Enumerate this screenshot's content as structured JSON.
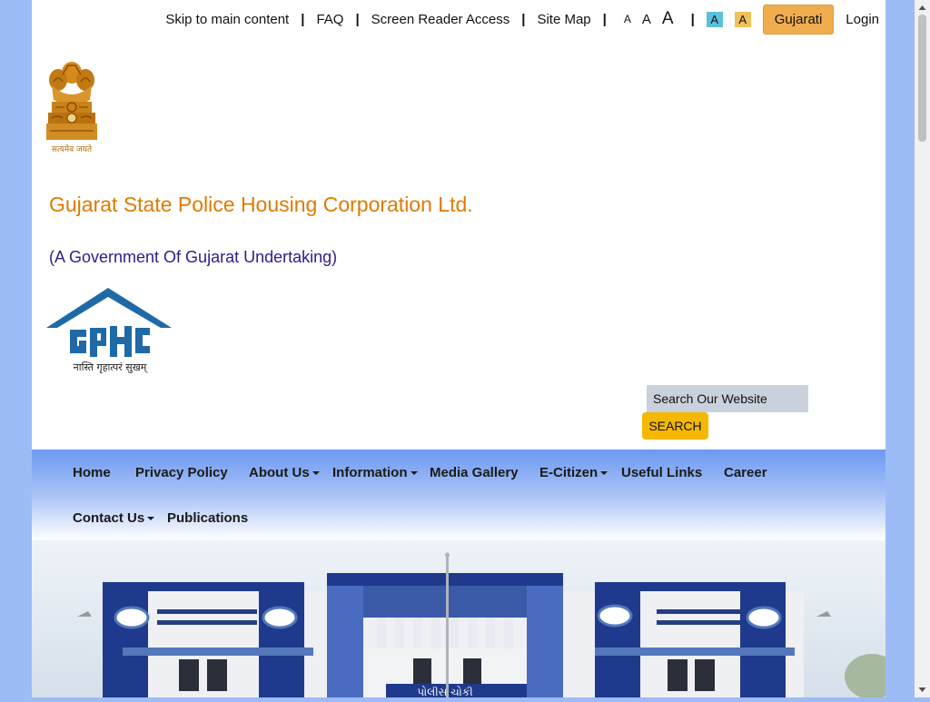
{
  "topbar": {
    "skip": "Skip to main content",
    "faq": "FAQ",
    "screen_reader": "Screen Reader Access",
    "site_map": "Site Map",
    "sep": "|",
    "font_small": "A",
    "font_normal": "A",
    "font_large": "A",
    "contrast_blue": "A",
    "contrast_yellow": "A",
    "language": "Gujarati",
    "login": "Login"
  },
  "header": {
    "emblem_motto": "सत्यमेव जयते",
    "org_name": "Gujarat State Police Housing Corporation Ltd.",
    "org_sub": "(A Government Of Gujarat Undertaking)",
    "logo_motto": "नास्ति गृहात्परं सुखम्"
  },
  "search": {
    "placeholder": "Search Our Website",
    "button": "SEARCH"
  },
  "nav": {
    "home": "Home",
    "privacy": "Privacy Policy",
    "about": "About Us",
    "information": "Information",
    "media": "Media Gallery",
    "ecitizen": "E-Citizen",
    "useful": "Useful Links",
    "career": "Career",
    "contact": "Contact Us",
    "publications": "Publications"
  },
  "banner": {
    "sign_text": "પોલીસ ચોકી"
  },
  "colors": {
    "background": "#9dbcf7",
    "org_name": "#e07b00",
    "org_sub": "#2a1e8c",
    "lang_button": "#f0ad4e",
    "search_button": "#f5b800",
    "logo_blue": "#1f6aa6",
    "building_blue": "#1f3a8c"
  }
}
